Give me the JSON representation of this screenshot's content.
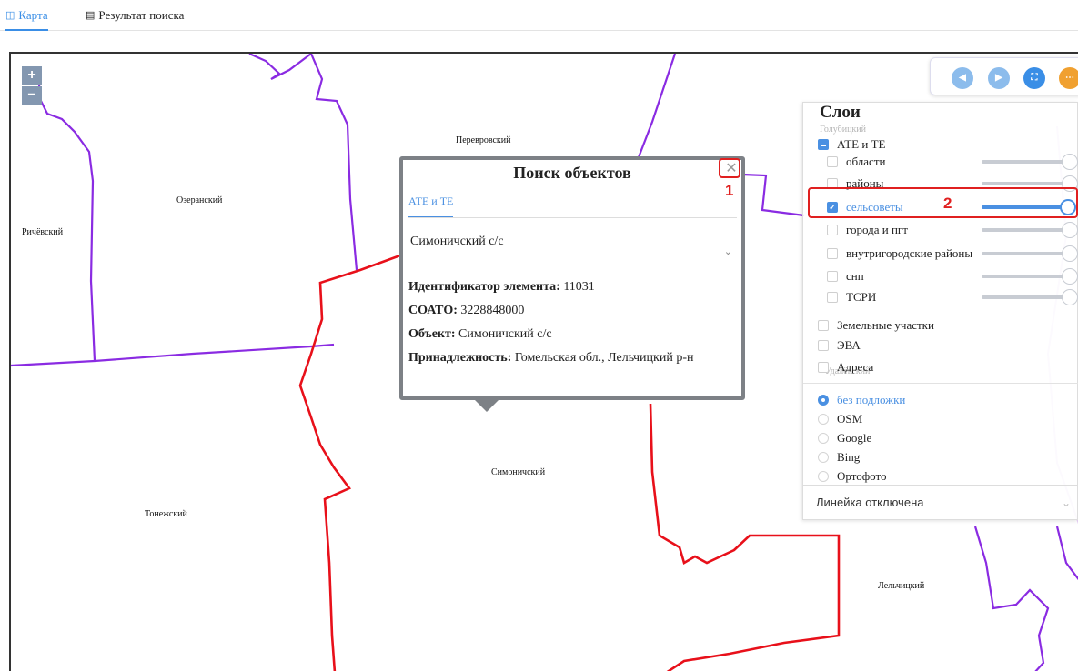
{
  "tabs": [
    {
      "label": "Карта",
      "icon": "map-book-icon",
      "active": true
    },
    {
      "label": "Результат поиска",
      "icon": "document-icon",
      "active": false
    }
  ],
  "map": {
    "zoom_in": "+",
    "zoom_out": "−",
    "labels": {
      "perevorsky": "Перевровский",
      "ozeransky": "Озеранский",
      "richevsky": "Ричёвский",
      "simonichsky": "Симоничский",
      "tonezhsky": "Тонежский",
      "lelchitsky": "Лельчицкий"
    },
    "controls": [
      {
        "name": "back-icon",
        "color": "#8cbcec"
      },
      {
        "name": "forward-icon",
        "color": "#8cbcec"
      },
      {
        "name": "fullscreen-icon",
        "color": "#3a8ee6"
      },
      {
        "name": "more-icon",
        "color": "#f0a030"
      }
    ],
    "colors": {
      "ate_border": "#8a2be2",
      "selected_border": "#e8101a"
    }
  },
  "layers": {
    "title": "Слои",
    "ghost_top": "Голубицкий",
    "ghost_bottom": "Удалёвский",
    "group": "АТЕ и ТЕ",
    "items": [
      {
        "label": "области",
        "checked": false,
        "opacity": 1.0
      },
      {
        "label": "районы",
        "checked": false,
        "opacity": 1.0
      },
      {
        "label": "сельсоветы",
        "checked": true,
        "opacity": 1.0
      },
      {
        "label": "города и пгт",
        "checked": false,
        "opacity": 1.0
      },
      {
        "label": "внутригородские районы",
        "checked": false,
        "opacity": 1.0
      },
      {
        "label": "снп",
        "checked": false,
        "opacity": 1.0
      },
      {
        "label": "ТСРИ",
        "checked": false,
        "opacity": 1.0
      }
    ],
    "extra": [
      "Земельные участки",
      "ЭВА",
      "Адреса"
    ],
    "basemaps": [
      {
        "label": "без подложки",
        "selected": true
      },
      {
        "label": "OSM",
        "selected": false
      },
      {
        "label": "Google",
        "selected": false
      },
      {
        "label": "Bing",
        "selected": false
      },
      {
        "label": "Ортофото",
        "selected": false
      }
    ],
    "ruler": "Линейка отключена"
  },
  "popup": {
    "title": "Поиск объектов",
    "tab": "АТЕ и ТЕ",
    "selected": "Симоничский с/с",
    "fields": [
      {
        "key": "Идентификатор элемента:",
        "value": "11031"
      },
      {
        "key": "СОАТО:",
        "value": "3228848000"
      },
      {
        "key": "Объект:",
        "value": "Симоничский с/с"
      },
      {
        "key": "Принадлежность:",
        "value": "Гомельская обл., Лельчицкий р-н"
      }
    ]
  },
  "annotations": {
    "one": "1",
    "two": "2"
  }
}
